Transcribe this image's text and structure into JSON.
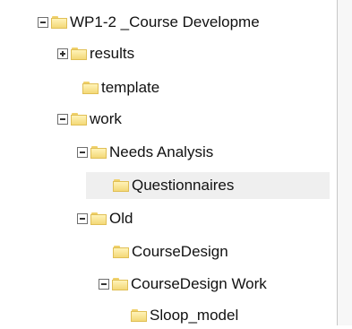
{
  "tree": {
    "items": [
      {
        "label": "WP1-2 _Course Developme",
        "toggle": "minus",
        "depth": 0
      },
      {
        "label": "results",
        "toggle": "plus",
        "depth": 1
      },
      {
        "label": "template",
        "toggle": "none",
        "depth": 1
      },
      {
        "label": "work",
        "toggle": "minus",
        "depth": 1
      },
      {
        "label": "Needs Analysis",
        "toggle": "minus",
        "depth": 2
      },
      {
        "label": "Questionnaires",
        "toggle": "none",
        "depth": 3,
        "selected": true
      },
      {
        "label": "Old",
        "toggle": "minus",
        "depth": 2
      },
      {
        "label": "CourseDesign",
        "toggle": "none",
        "depth": 3
      },
      {
        "label": "CourseDesign Work",
        "toggle": "minus",
        "depth": 3
      },
      {
        "label": "Sloop_model",
        "toggle": "none",
        "depth": 4
      }
    ]
  }
}
